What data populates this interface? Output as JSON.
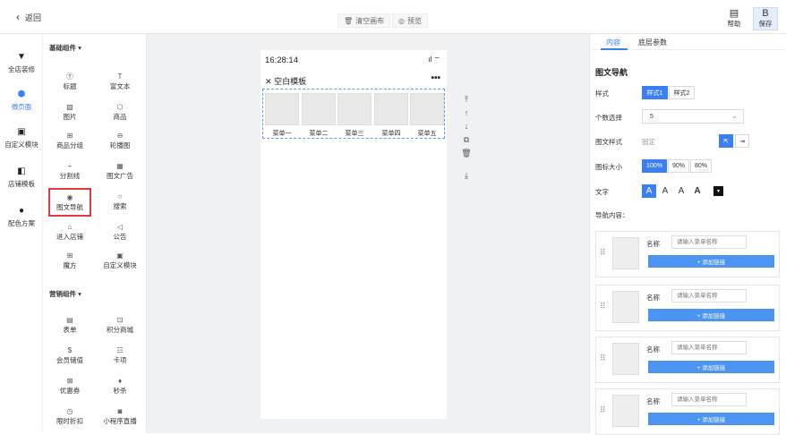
{
  "topbar": {
    "back_label": "返回",
    "clear_label": "清空画布",
    "preview_label": "预览",
    "help_label": "帮助",
    "save_label": "保存"
  },
  "leftnav": {
    "items": [
      {
        "label": "全店装修",
        "icon": "brush-icon"
      },
      {
        "label": "微页面",
        "icon": "cube-icon",
        "active": true
      },
      {
        "label": "自定义模块",
        "icon": "module-icon"
      },
      {
        "label": "店铺模板",
        "icon": "template-icon"
      },
      {
        "label": "配色方案",
        "icon": "palette-icon"
      }
    ]
  },
  "components": {
    "basic_title": "基础组件",
    "basic": [
      "标题",
      "富文本",
      "图片",
      "商品",
      "商品分组",
      "轮播图",
      "分割线",
      "图文广告",
      "图文导航",
      "搜索",
      "进入店铺",
      "公告",
      "魔方",
      "自定义模块"
    ],
    "marketing_title": "营销组件",
    "marketing": [
      "表单",
      "积分商城",
      "会员储值",
      "卡项",
      "优惠券",
      "秒杀",
      "限时折扣",
      "小程序直播"
    ]
  },
  "phone": {
    "time": "16:28:14",
    "title": "空白模板",
    "nav_items": [
      "菜单一",
      "菜单二",
      "菜单三",
      "菜单四",
      "菜单五"
    ]
  },
  "panel": {
    "tab_content": "内容",
    "tab_bottom": "底层参数",
    "title": "图文导航",
    "style_label": "样式",
    "style_opts": [
      "样式1",
      "样式2"
    ],
    "count_label": "个数选择",
    "count_value": "5",
    "imgstyle_label": "图文样式",
    "imgstyle_value": "固定",
    "iconsize_label": "图标大小",
    "iconsize_opts": [
      "100%",
      "90%",
      "80%"
    ],
    "text_label": "文字",
    "text_opts": [
      "A",
      "A",
      "A",
      "A"
    ],
    "nav_content_label": "导航内容：",
    "card_name_label": "名称",
    "card_placeholder": "请输入菜单名称",
    "card_add_label": "+ 添加链接"
  },
  "colors": {
    "accent": "#3a7ff6",
    "highlight": "#e23b3b",
    "canvas_bg": "#f0f1f3"
  }
}
